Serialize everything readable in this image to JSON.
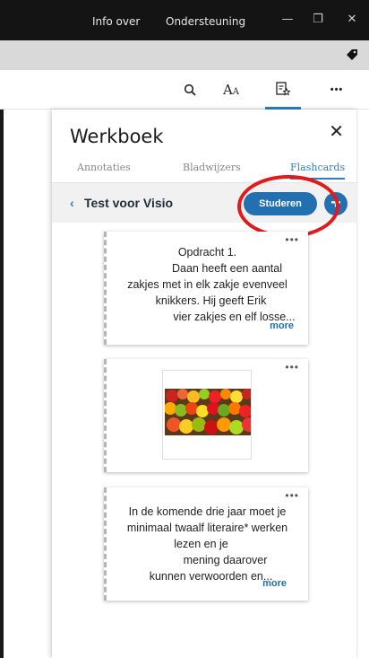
{
  "titlebar": {
    "info_label": "Info over",
    "support_label": "Ondersteuning",
    "minimize": "—",
    "restore": "❐",
    "close": "✕"
  },
  "toolbar": {
    "font_label_big": "A",
    "font_label_small": "A",
    "more": "•••"
  },
  "panel": {
    "title": "Werkboek",
    "close": "✕",
    "tabs": [
      {
        "label": "Annotaties",
        "active": false
      },
      {
        "label": "Bladwijzers",
        "active": false
      },
      {
        "label": "Flashcards",
        "active": true
      }
    ],
    "deck": {
      "back": "‹",
      "title": "Test voor Visio",
      "study_label": "Studeren",
      "add_label": "+"
    }
  },
  "cards": [
    {
      "menu": "•••",
      "lines": [
        "Opdracht 1.",
        "Daan heeft een aantal",
        "zakjes met in elk zakje evenveel",
        "knikkers. Hij geeft Erik",
        "vier zakjes en elf losse..."
      ],
      "more": "more"
    },
    {
      "menu": "•••",
      "image": "fruit-market-photo"
    },
    {
      "menu": "•••",
      "lines": [
        "In de komende drie jaar moet je",
        "minimaal twaalf literaire* werken",
        "lezen en je",
        "mening daarover",
        "kunnen verwoorden en..."
      ],
      "more": "more"
    }
  ],
  "colors": {
    "accent": "#2270b0",
    "annotation_ring": "#e01b1b",
    "titlebar": "#141414"
  }
}
